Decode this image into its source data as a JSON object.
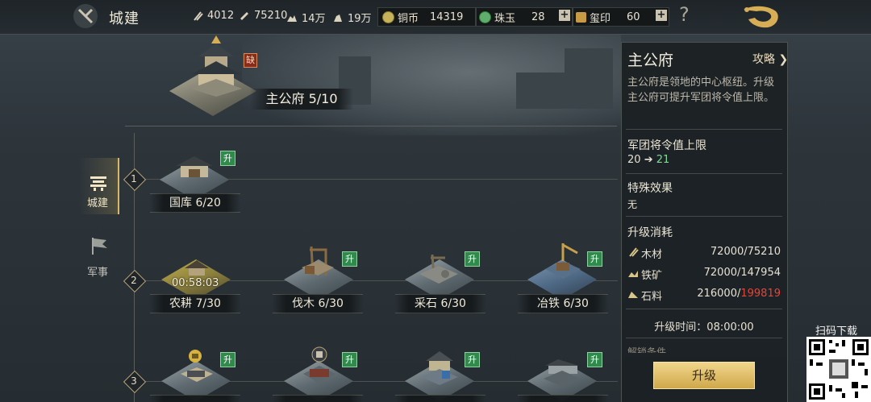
{
  "topbar": {
    "title": "城建",
    "resources": [
      {
        "icon": "wood-icon",
        "value": "4012"
      },
      {
        "icon": "iron-icon",
        "value": "75210"
      },
      {
        "icon": "stone-icon",
        "value": "14万"
      },
      {
        "icon": "grain-icon",
        "value": "19万"
      }
    ],
    "currencies": [
      {
        "label": "铜币",
        "value": "14319"
      },
      {
        "label": "珠玉",
        "value": "28"
      },
      {
        "label": "玺印",
        "value": "60"
      }
    ],
    "plus": "+",
    "help": "?"
  },
  "nav": [
    {
      "label": "城建",
      "active": true,
      "icon": "city-build-icon"
    },
    {
      "label": "军事",
      "active": false,
      "icon": "military-flag-icon"
    }
  ],
  "main_building": {
    "name": "主公府 5/10",
    "badge": "缺"
  },
  "tiers": [
    "1",
    "2",
    "3"
  ],
  "buildings": [
    {
      "id": "treasury",
      "name": "国库 6/20",
      "badge": "升",
      "tier": 1
    },
    {
      "id": "farm",
      "name": "农耕 7/30",
      "timer": "00:58:03",
      "tier": 2
    },
    {
      "id": "lumber",
      "name": "伐木 6/30",
      "badge": "升",
      "tier": 2
    },
    {
      "id": "quarry",
      "name": "采石 6/30",
      "badge": "升",
      "tier": 2
    },
    {
      "id": "smelter",
      "name": "冶铁 6/30",
      "badge": "升",
      "tier": 2
    },
    {
      "id": "t3a",
      "name": "",
      "badge": "升",
      "tier": 3
    },
    {
      "id": "t3b",
      "name": "",
      "badge": "升",
      "tier": 3
    },
    {
      "id": "t3c",
      "name": "",
      "badge": "升",
      "tier": 3
    },
    {
      "id": "t3d",
      "name": "",
      "badge": "升",
      "tier": 3
    }
  ],
  "panel": {
    "title": "主公府",
    "guide": "攻略",
    "description": "主公府是领地的中心枢纽。升级主公府可提升军团将令值上限。",
    "cap_heading": "军团将令值上限",
    "cap_from": "20",
    "cap_arrow": "➔",
    "cap_to": "21",
    "effect_heading": "特殊效果",
    "effect_value": "无",
    "cost_heading": "升级消耗",
    "costs": [
      {
        "label": "木材",
        "have": "72000/75210",
        "short": ""
      },
      {
        "label": "铁矿",
        "have": "72000/147954",
        "short": ""
      },
      {
        "label": "石料",
        "need": "216000/",
        "short": "199819"
      }
    ],
    "time": "升级时间：08:00:00",
    "more": "解锁条件",
    "upgrade_button": "升级"
  },
  "qr": {
    "label": "扫码下载"
  },
  "colors": {
    "accent_gold": "#d8b766",
    "badge_green": "#2f8a4c",
    "shortage_red": "#e2463a",
    "increase_green": "#7fdc97"
  }
}
